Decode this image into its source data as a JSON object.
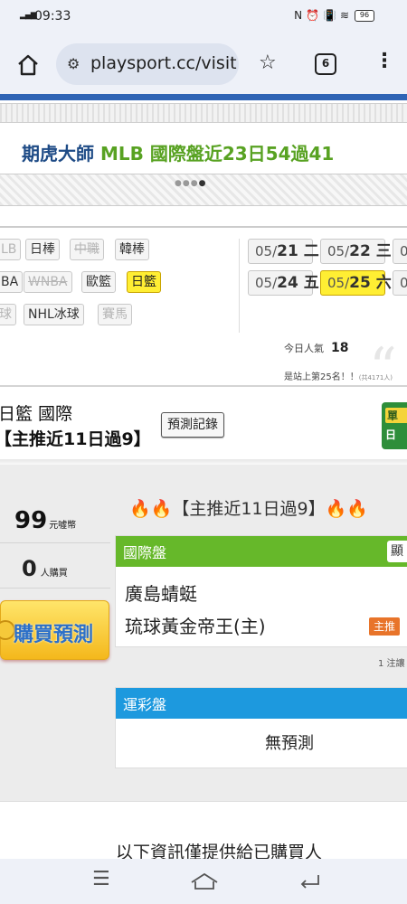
{
  "status_bar": {
    "time": "09:33",
    "battery": "96"
  },
  "browser": {
    "url": "playsport.cc/visit",
    "tab_count": "6"
  },
  "headline": {
    "name": "期虎大師",
    "stats": "MLB 國際盤近23日54過41"
  },
  "sports": [
    {
      "label": "LB",
      "style": "dim"
    },
    {
      "label": "日棒",
      "style": "normal"
    },
    {
      "label": "中職",
      "style": "strike"
    },
    {
      "label": "韓棒",
      "style": "normal"
    },
    {
      "label": "BA",
      "style": "normal"
    },
    {
      "label": "WNBA",
      "style": "strike"
    },
    {
      "label": "歐籃",
      "style": "normal"
    },
    {
      "label": "日籃",
      "style": "selected"
    },
    {
      "label": "球",
      "style": "dim"
    },
    {
      "label": "NHL冰球",
      "style": "normal"
    },
    {
      "label": "賽馬",
      "style": "dim"
    }
  ],
  "dates": [
    {
      "month": "05/",
      "day": "21 二",
      "selected": false
    },
    {
      "month": "05/",
      "day": "22 三",
      "selected": false
    },
    {
      "month": "0",
      "day": "",
      "selected": false
    },
    {
      "month": "05/",
      "day": "24 五",
      "selected": false
    },
    {
      "month": "05/",
      "day": "25 六",
      "selected": true
    },
    {
      "month": "0",
      "day": "",
      "selected": false
    }
  ],
  "popularity": {
    "label": "今日人氣",
    "value": "18",
    "rank_text": "是站上第25名！！",
    "rank_sub": "(共4171人)"
  },
  "league": {
    "title": "日籃 國際",
    "record_button": "預測記錄",
    "tagline": "【主推近11日過9】",
    "ribbon_top": "單",
    "ribbon_bottom": "日"
  },
  "purchase": {
    "price": "99",
    "price_unit": "元噓幣",
    "buyers": "0",
    "buyers_unit": "人購買",
    "buy_button": "購買預測"
  },
  "promo": {
    "text": "【主推近11日過9】",
    "fire_icon": "🔥🔥"
  },
  "international": {
    "title": "國際盤",
    "button": "顯",
    "team1": "廣島蜻蜓",
    "team2": "琉球黃金帝王(主)",
    "main_badge": "主推",
    "notes": "1 注讓"
  },
  "lottery": {
    "title": "運彩盤",
    "no_prediction": "無預測"
  },
  "info": {
    "text": "以下資訊僅提供給已購買人"
  },
  "colors": {
    "brand_blue": "#2f64b5",
    "green": "#66b82a",
    "blue": "#1d99de",
    "yellow": "#ffee33",
    "orange": "#e8742a"
  }
}
